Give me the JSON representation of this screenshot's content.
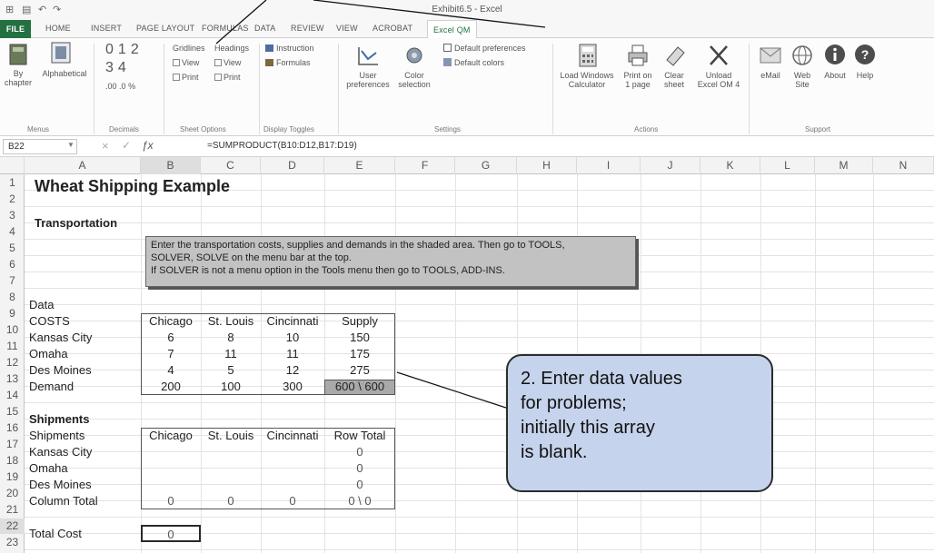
{
  "window": {
    "title": "Exhibit6.5 - Excel",
    "quick_access": [
      "⊞",
      "▤",
      "↶",
      "↷"
    ]
  },
  "tabs": [
    "FILE",
    "HOME",
    "INSERT",
    "PAGE LAYOUT",
    "FORMULAS",
    "DATA",
    "REVIEW",
    "VIEW",
    "ACROBAT",
    "Excel QM"
  ],
  "active_tab": "Excel QM",
  "ribbon": {
    "by_chapter": [
      "By",
      "chapter"
    ],
    "alphabetical": "Alphabetical",
    "menus_group": "Menus",
    "decimals_digits": [
      "0",
      "1",
      "2",
      "3",
      "4"
    ],
    "decimals_small": [
      ".00",
      ".0",
      "%"
    ],
    "decimals_group": "Decimals",
    "gridlines_label": "Gridlines",
    "headings_label": "Headings",
    "view_label": "View",
    "print_label": "Print",
    "sheet_options_group": "Sheet Options",
    "instruction_label": "Instruction",
    "formulas_label": "Formulas",
    "display_toggles_group": "Display Toggles",
    "user_preferences": [
      "User",
      "preferences"
    ],
    "color_selection": [
      "Color",
      "selection"
    ],
    "default_preferences": "Default preferences",
    "default_colors": "Default colors",
    "settings_group": "Settings",
    "load_windows_calculator": [
      "Load Windows",
      "Calculator"
    ],
    "print_on_1_page": [
      "Print on",
      "1 page"
    ],
    "clear_sheet": [
      "Clear",
      "sheet"
    ],
    "unload_excel_om": [
      "Unload",
      "Excel OM 4"
    ],
    "actions_group": "Actions",
    "email": "eMail",
    "web_site": [
      "Web",
      "Site"
    ],
    "about": "About",
    "help": "Help",
    "support_group": "Support"
  },
  "formula_bar": {
    "name_box": "B22",
    "formula": "=SUMPRODUCT(B10:D12,B17:D19)"
  },
  "grid": {
    "columns": [
      "A",
      "B",
      "C",
      "D",
      "E",
      "F",
      "G",
      "H",
      "I",
      "J",
      "K",
      "L",
      "M",
      "N"
    ],
    "rows": [
      "1",
      "2",
      "3",
      "4",
      "5",
      "6",
      "7",
      "8",
      "9",
      "10",
      "11",
      "12",
      "13",
      "14",
      "15",
      "16",
      "17",
      "18",
      "19",
      "20",
      "21",
      "22",
      "23"
    ]
  },
  "sheet": {
    "title": "Wheat Shipping Example",
    "transportation_label": "Transportation",
    "instructions": [
      "Enter the transportation costs, supplies and demands in the shaded area. Then go to TOOLS,",
      "SOLVER, SOLVE on the menu bar at the top.",
      "If SOLVER is not a menu option in the Tools menu then go to TOOLS, ADD-INS."
    ],
    "data_label": "Data",
    "costs_header": [
      "COSTS",
      "Chicago",
      "St. Louis",
      "Cincinnati",
      "Supply"
    ],
    "costs_rows": [
      [
        "Kansas City",
        "6",
        "8",
        "10",
        "150"
      ],
      [
        "Omaha",
        "7",
        "11",
        "11",
        "175"
      ],
      [
        "Des Moines",
        "4",
        "5",
        "12",
        "275"
      ]
    ],
    "demand_row": [
      "Demand",
      "200",
      "100",
      "300",
      "600 \\ 600"
    ],
    "shipments_label": "Shipments",
    "ship_header": [
      "Shipments",
      "Chicago",
      "St. Louis",
      "Cincinnati",
      "Row Total"
    ],
    "ship_rows": [
      [
        "Kansas City",
        "",
        "",
        "",
        "0"
      ],
      [
        "Omaha",
        "",
        "",
        "",
        "0"
      ],
      [
        "Des Moines",
        "",
        "",
        "",
        "0"
      ]
    ],
    "column_total_row": [
      "Column Total",
      "0",
      "0",
      "0",
      "0 \\ 0"
    ],
    "total_cost_label": "Total Cost",
    "total_cost_value": "0"
  },
  "callout": {
    "lines": [
      "2. Enter data values",
      "for problems;",
      "initially this array",
      "is blank."
    ]
  },
  "colors": {
    "file_tab": "#237042",
    "callout_fill": "#c6d3ec",
    "instruction_fill": "#c2c2c2",
    "supply_total_fill": "#a9a9a9"
  }
}
